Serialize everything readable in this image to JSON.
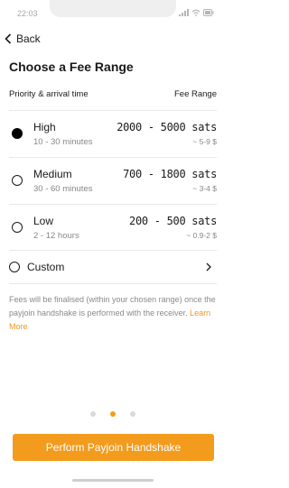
{
  "status_bar": {
    "time": "22:03"
  },
  "nav": {
    "back_label": "Back"
  },
  "page": {
    "title": "Choose a Fee Range"
  },
  "table_header": {
    "left": "Priority & arrival time",
    "right": "Fee Range"
  },
  "options": [
    {
      "name": "High",
      "time": "10 - 30 minutes",
      "sats": "2000 - 5000 sats",
      "fiat": "~ 5-9 $",
      "selected": true
    },
    {
      "name": "Medium",
      "time": "30 - 60 minutes",
      "sats": "700 - 1800 sats",
      "fiat": "~ 3-4 $",
      "selected": false
    },
    {
      "name": "Low",
      "time": "2 - 12 hours",
      "sats": "200 - 500 sats",
      "fiat": "~ 0.9-2 $",
      "selected": false
    }
  ],
  "custom": {
    "label": "Custom"
  },
  "note": {
    "text": "Fees will be finalised (within your chosen range) once the payjoin handshake is performed with the receiver.",
    "link": "Learn More"
  },
  "pagination": {
    "total": 3,
    "active": 2
  },
  "cta": {
    "label": "Perform Payjoin Handshake"
  },
  "colors": {
    "accent": "#f39b1d",
    "text": "#1a1a1a",
    "muted": "#888888"
  }
}
